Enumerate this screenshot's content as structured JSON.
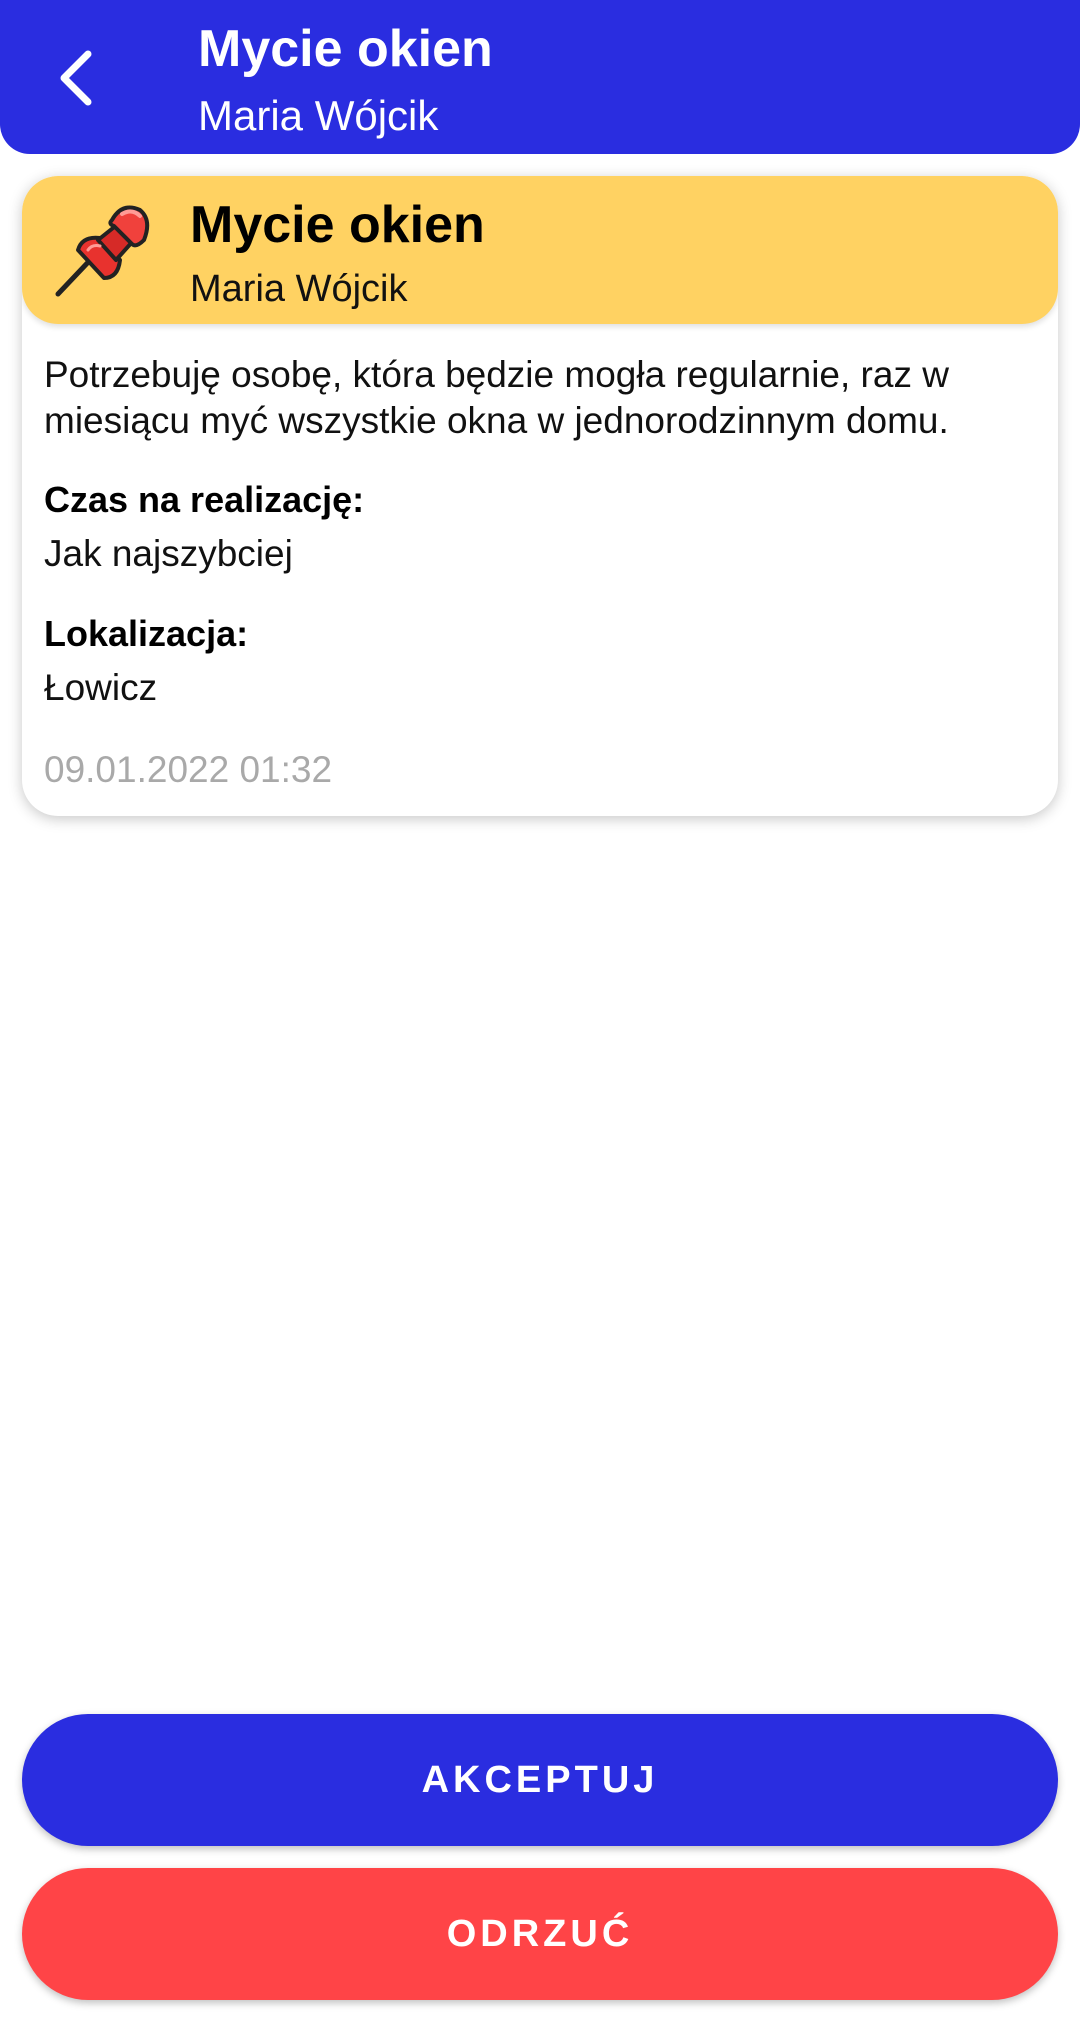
{
  "app_bar": {
    "title": "Mycie okien",
    "subtitle": "Maria Wójcik",
    "color": "#2a2de0"
  },
  "card": {
    "icon": "pushpin-icon",
    "header_color": "#ffd262",
    "title": "Mycie okien",
    "author": "Maria Wójcik",
    "description": "Potrzebuję osobę, która będzie mogła regularnie, raz w miesiącu myć wszystkie okna w jednorodzinnym domu.",
    "deadline_label": "Czas na realizację:",
    "deadline_value": "Jak najszybciej",
    "location_label": "Lokalizacja:",
    "location_value": "Łowicz",
    "timestamp": "09.01.2022 01:32"
  },
  "actions": {
    "accept_label": "AKCEPTUJ",
    "accept_color": "#2a2de0",
    "reject_label": "ODRZUĆ",
    "reject_color": "#ff4447"
  }
}
